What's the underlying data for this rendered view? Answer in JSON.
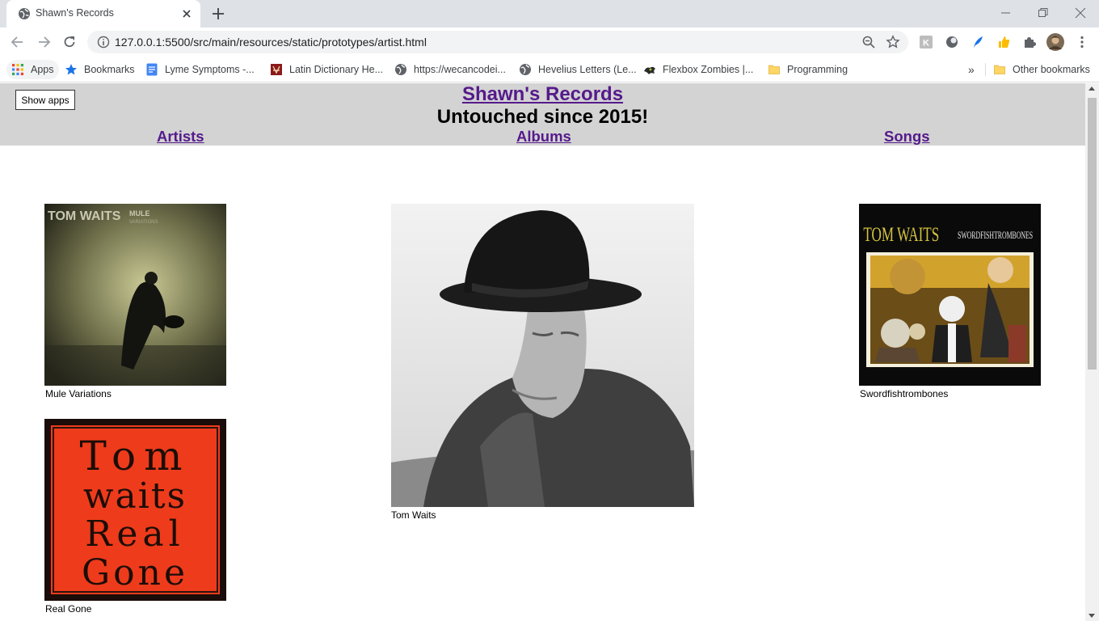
{
  "browser": {
    "tab_title": "Shawn's Records",
    "url": "127.0.0.1:5500/src/main/resources/static/prototypes/artist.html",
    "bookmarks": [
      {
        "label": "Apps",
        "icon": "apps-grid-icon"
      },
      {
        "label": "Bookmarks",
        "icon": "star-icon"
      },
      {
        "label": "Lyme Symptoms -...",
        "icon": "docs-icon"
      },
      {
        "label": "Latin Dictionary He...",
        "icon": "latin-dictionary-icon"
      },
      {
        "label": "https://wecancodei...",
        "icon": "globe-icon"
      },
      {
        "label": "Hevelius Letters (Le...",
        "icon": "globe-icon"
      },
      {
        "label": "Flexbox Zombies |...",
        "icon": "zombie-icon"
      },
      {
        "label": "Programming",
        "icon": "folder-icon"
      }
    ],
    "other_bookmarks": "Other bookmarks",
    "more_bookmarks": "»"
  },
  "page": {
    "show_apps_label": "Show apps",
    "site_title": "Shawn's Records",
    "tagline": "Untouched since 2015!",
    "nav": {
      "artists": "Artists",
      "albums": "Albums",
      "songs": "Songs"
    },
    "artist": {
      "name": "Tom Waits"
    },
    "albums": [
      {
        "title": "Mule Variations",
        "cover_text": [
          "TOM WAITS",
          "MULE",
          "VARIATIONS"
        ]
      },
      {
        "title": "Swordfishtrombones",
        "cover_text": [
          "TOM WAITS",
          "SWORDFISHTROMBONES"
        ]
      },
      {
        "title": "Real Gone",
        "cover_text": [
          "Tom",
          "waits",
          "Real",
          "Gone"
        ]
      }
    ]
  }
}
